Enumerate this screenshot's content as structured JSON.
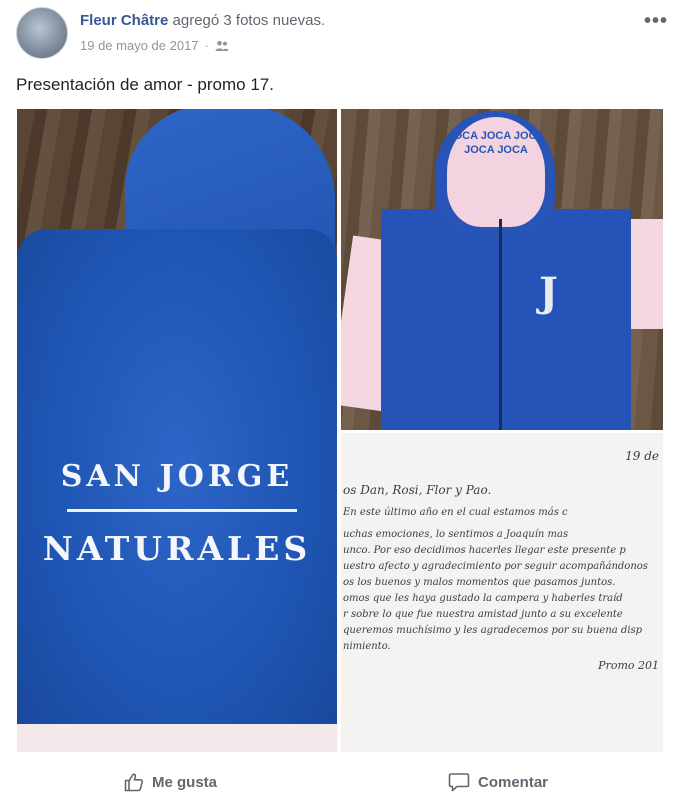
{
  "post": {
    "author": "Fleur Châtre",
    "action": "agregó 3 fotos nuevas.",
    "date": "19 de mayo de 2017",
    "date_separator": "·",
    "caption": "Presentación de amor - promo 17.",
    "more_label": "•••"
  },
  "photos": {
    "photo1": {
      "embroidery_line1": "SAN JORGE",
      "embroidery_line2": "NATURALES"
    },
    "photo2": {
      "hood_print": "JOCA JOCA JOCA JOCA JOCA",
      "chest_letter": "J"
    },
    "photo3": {
      "date": "19 de",
      "greeting": "os Dan, Rosi, Flor y Pao.",
      "lines": [
        "En este último año en el cual estamos más c",
        "uchas emociones, lo sentimos a Joaquín mas",
        "unco. Por eso decidimos hacerles llegar este presente p",
        "uestro afecto y agradecimiento por seguir acompañándonos",
        "os los buenos y malos momentos que pasamos juntos.",
        "omos que les haya gustado la campera y haberles traíd",
        "r sobre lo que fue nuestra amistad junto a su excelente",
        "queremos muchísimo y les agradecemos por su buena disp",
        "nimiento."
      ],
      "signature": "Promo 201"
    }
  },
  "actions": {
    "like_label": "Me gusta",
    "comment_label": "Comentar"
  },
  "colors": {
    "author_link": "#365899",
    "meta_text": "#90949c",
    "action_text": "#616770"
  }
}
